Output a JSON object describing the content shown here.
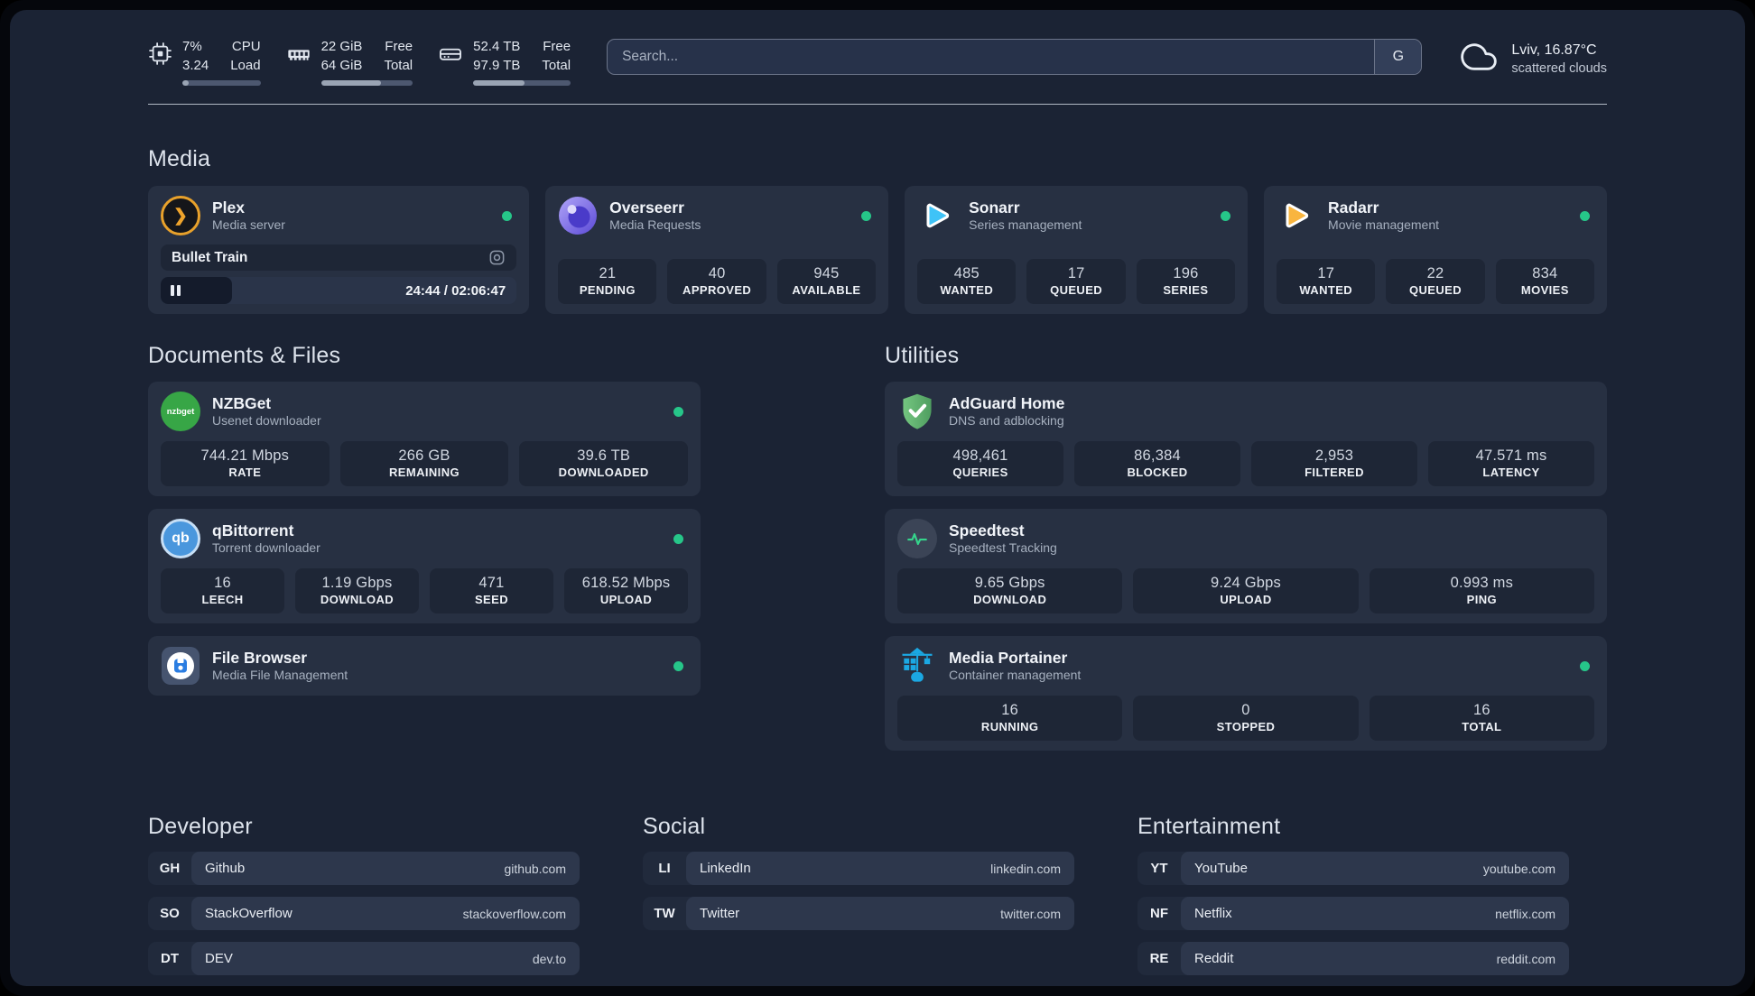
{
  "header": {
    "metrics": [
      {
        "icon": "cpu-icon",
        "values": [
          "7%",
          "3.24"
        ],
        "labels": [
          "CPU",
          "Load"
        ],
        "progress_pct": 8
      },
      {
        "icon": "memory-icon",
        "values": [
          "22 GiB",
          "64 GiB"
        ],
        "labels": [
          "Free",
          "Total"
        ],
        "progress_pct": 65
      },
      {
        "icon": "storage-icon",
        "values": [
          "52.4 TB",
          "97.9 TB"
        ],
        "labels": [
          "Free",
          "Total"
        ],
        "progress_pct": 53
      }
    ],
    "search": {
      "placeholder": "Search...",
      "engine": "G"
    },
    "weather": {
      "location": "Lviv, 16.87°C",
      "condition": "scattered clouds"
    }
  },
  "sections": {
    "media": "Media",
    "documents": "Documents & Files",
    "utilities": "Utilities",
    "developer": "Developer",
    "social": "Social",
    "entertainment": "Entertainment"
  },
  "apps": {
    "plex": {
      "name": "Plex",
      "subtitle": "Media server",
      "now_playing": "Bullet Train",
      "time": "24:44 / 02:06:47",
      "progress_pct": 20
    },
    "overseerr": {
      "name": "Overseerr",
      "subtitle": "Media Requests",
      "stats": [
        {
          "value": "21",
          "label": "PENDING"
        },
        {
          "value": "40",
          "label": "APPROVED"
        },
        {
          "value": "945",
          "label": "AVAILABLE"
        }
      ]
    },
    "sonarr": {
      "name": "Sonarr",
      "subtitle": "Series management",
      "stats": [
        {
          "value": "485",
          "label": "WANTED"
        },
        {
          "value": "17",
          "label": "QUEUED"
        },
        {
          "value": "196",
          "label": "SERIES"
        }
      ]
    },
    "radarr": {
      "name": "Radarr",
      "subtitle": "Movie management",
      "stats": [
        {
          "value": "17",
          "label": "WANTED"
        },
        {
          "value": "22",
          "label": "QUEUED"
        },
        {
          "value": "834",
          "label": "MOVIES"
        }
      ]
    },
    "nzbget": {
      "name": "NZBGet",
      "subtitle": "Usenet downloader",
      "stats": [
        {
          "value": "744.21 Mbps",
          "label": "RATE"
        },
        {
          "value": "266 GB",
          "label": "REMAINING"
        },
        {
          "value": "39.6 TB",
          "label": "DOWNLOADED"
        }
      ]
    },
    "qbittorrent": {
      "name": "qBittorrent",
      "subtitle": "Torrent downloader",
      "stats": [
        {
          "value": "16",
          "label": "LEECH"
        },
        {
          "value": "1.19 Gbps",
          "label": "DOWNLOAD"
        },
        {
          "value": "471",
          "label": "SEED"
        },
        {
          "value": "618.52 Mbps",
          "label": "UPLOAD"
        }
      ]
    },
    "filebrowser": {
      "name": "File Browser",
      "subtitle": "Media File Management"
    },
    "adguard": {
      "name": "AdGuard Home",
      "subtitle": "DNS and adblocking",
      "stats": [
        {
          "value": "498,461",
          "label": "QUERIES"
        },
        {
          "value": "86,384",
          "label": "BLOCKED"
        },
        {
          "value": "2,953",
          "label": "FILTERED"
        },
        {
          "value": "47.571 ms",
          "label": "LATENCY"
        }
      ]
    },
    "speedtest": {
      "name": "Speedtest",
      "subtitle": "Speedtest Tracking",
      "stats": [
        {
          "value": "9.65 Gbps",
          "label": "DOWNLOAD"
        },
        {
          "value": "9.24 Gbps",
          "label": "UPLOAD"
        },
        {
          "value": "0.993 ms",
          "label": "PING"
        }
      ]
    },
    "portainer": {
      "name": "Media Portainer",
      "subtitle": "Container management",
      "stats": [
        {
          "value": "16",
          "label": "RUNNING"
        },
        {
          "value": "0",
          "label": "STOPPED"
        },
        {
          "value": "16",
          "label": "TOTAL"
        }
      ]
    }
  },
  "icon_labels": {
    "plex": "❯",
    "nzbget": "nzbget",
    "qbittorrent": "qb"
  },
  "bookmarks": {
    "developer": [
      {
        "abbr": "GH",
        "name": "Github",
        "domain": "github.com"
      },
      {
        "abbr": "SO",
        "name": "StackOverflow",
        "domain": "stackoverflow.com"
      },
      {
        "abbr": "DT",
        "name": "DEV",
        "domain": "dev.to"
      }
    ],
    "social": [
      {
        "abbr": "LI",
        "name": "LinkedIn",
        "domain": "linkedin.com"
      },
      {
        "abbr": "TW",
        "name": "Twitter",
        "domain": "twitter.com"
      }
    ],
    "entertainment": [
      {
        "abbr": "YT",
        "name": "YouTube",
        "domain": "youtube.com"
      },
      {
        "abbr": "NF",
        "name": "Netflix",
        "domain": "netflix.com"
      },
      {
        "abbr": "RE",
        "name": "Reddit",
        "domain": "reddit.com"
      }
    ]
  },
  "colors": {
    "status_online": "#26c689",
    "plex_orange": "#e8a12b",
    "sonarr_blue": "#3fc3f7",
    "radarr_yellow": "#f9b53f",
    "nzbget_green": "#37a646",
    "adguard_green": "#67b573",
    "portainer_blue": "#1ba8e3",
    "background": "#1b2334",
    "card": "#273042"
  }
}
